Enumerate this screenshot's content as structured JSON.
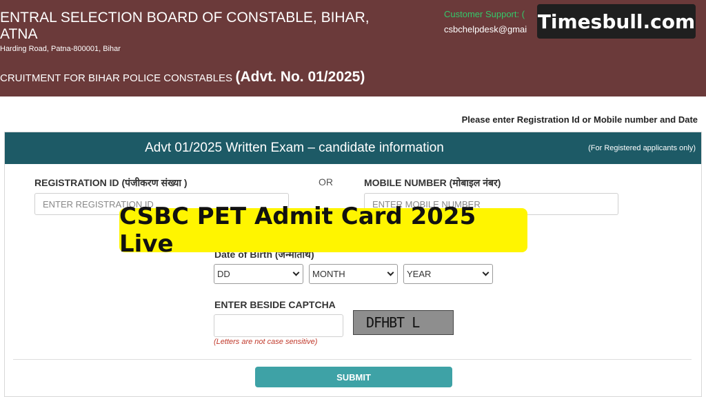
{
  "header": {
    "org_line1": "ENTRAL SELECTION BOARD OF CONSTABLE, BIHAR,",
    "org_line2": "ATNA",
    "address": "Harding Road, Patna-800001, Bihar",
    "recruit_text": "CRUITMENT FOR BIHAR POLICE CONSTABLES",
    "advt": "(Advt. No. 01/2025)",
    "support_label": "Customer Support: (",
    "support_email": "csbchelpdesk@gmai"
  },
  "watermark": "Timesbull.com",
  "instruction": "Please enter Registration Id or Mobile number and Date",
  "card": {
    "title": "Advt 01/2025 Written Exam – candidate information",
    "note": "(For Registered applicants only)"
  },
  "form": {
    "registration_label": "REGISTRATION ID (पंजीकरण संख्या )",
    "registration_placeholder": "ENTER REGISTRATION ID",
    "or_text": "OR",
    "mobile_label": "MOBILE NUMBER (मोबाइल नंबर)",
    "mobile_placeholder": "ENTER MOBILE NUMBER",
    "dob_label": "Date of Birth (जन्मतिथि)",
    "dd": "DD",
    "month": "MONTH",
    "year": "YEAR",
    "captcha_label": "ENTER BESIDE CAPTCHA",
    "captcha_value": "",
    "captcha_text": "DFHBT L",
    "captcha_hint": "(Letters are not case sensitive)",
    "submit": "SUBMIT"
  },
  "banner": "CSBC PET Admit Card 2025 Live",
  "colors": {
    "header_bg": "#6b3a3a",
    "card_header_bg": "#1d5a66",
    "submit_bg": "#3ea2a6",
    "banner_bg": "#fff500",
    "support_green": "#34c96a",
    "hint_red": "#c0392b"
  }
}
